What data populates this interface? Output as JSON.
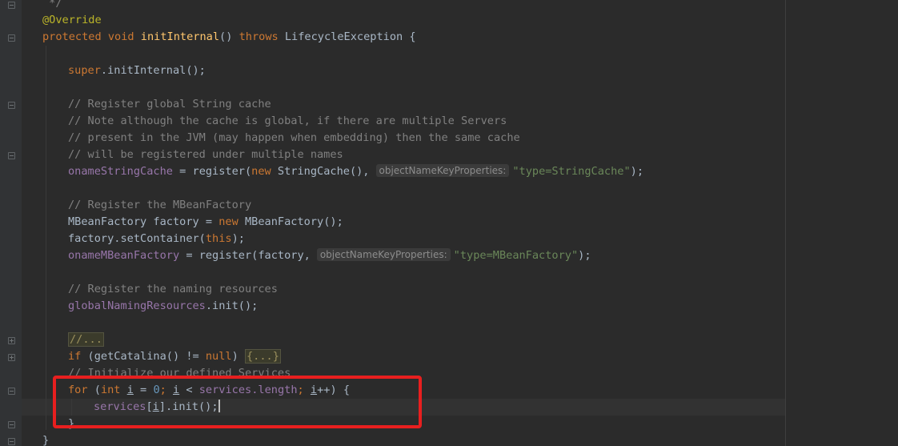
{
  "code": {
    "comment_end": " */",
    "annotation": "@Override",
    "l_protected": "protected",
    "l_void": "void",
    "l_method": "initInternal",
    "l_parens": "() ",
    "l_throws": "throws",
    "l_exc": " LifecycleException {",
    "l_super": "super",
    "l_super_rest": ".initInternal();",
    "c1": "// Register global String cache",
    "c2": "// Note although the cache is global, if there are multiple Servers",
    "c3": "// present in the JVM (may happen when embedding) then the same cache",
    "c4": "// will be registered under multiple names",
    "l_oname1": "onameStringCache",
    "l_eq_register1": " = register(",
    "l_new1": "new",
    "l_sc": " StringCache(),",
    "hint1": "objectNameKeyProperties:",
    "s1": "\"type=StringCache\"",
    "end1": ");",
    "c5": "// Register the MBeanFactory",
    "l_mbf_decl": "MBeanFactory factory = ",
    "l_new2": "new",
    "l_mbf_ctor": " MBeanFactory();",
    "l_factory_set": "factory.setContainer(",
    "l_this": "this",
    "l_close_paren": ");",
    "l_oname2": "onameMBeanFactory",
    "l_eq_register2": " = register(factory,",
    "hint2": "objectNameKeyProperties:",
    "s2": "\"type=MBeanFactory\"",
    "end2": ");",
    "c6": "// Register the naming resources",
    "l_gnr": "globalNamingResources",
    "l_gnr_rest": ".init();",
    "c7": "//...",
    "l_if": "if",
    "l_if_cond": " (getCatalina() != ",
    "l_null": "null",
    "l_if_close": ") ",
    "l_folded": "{...}",
    "c8": "// Initialize our defined Services",
    "l_for": "for",
    "l_for_open": " (",
    "l_int": "int",
    "l_i1": "i",
    "l_eq": " = ",
    "l_zero": "0",
    "l_semi1": "; ",
    "l_i2": "i",
    "l_lt": " < ",
    "l_services": "services",
    "l_length": ".length",
    "l_semi2": "; ",
    "l_i3": "i",
    "l_inc": "++) {",
    "l_services2": "services",
    "l_bracket_open": "[",
    "l_i4": "i",
    "l_bracket_close": "].init();",
    "l_close_brace_inner": "}",
    "l_close_brace_outer": "}"
  },
  "colors": {
    "background": "#2b2b2b",
    "keyword": "#cc7832",
    "string": "#6a8759",
    "comment": "#808080",
    "field": "#9876aa",
    "method": "#ffc66d",
    "highlight_box": "#e81f1f"
  }
}
